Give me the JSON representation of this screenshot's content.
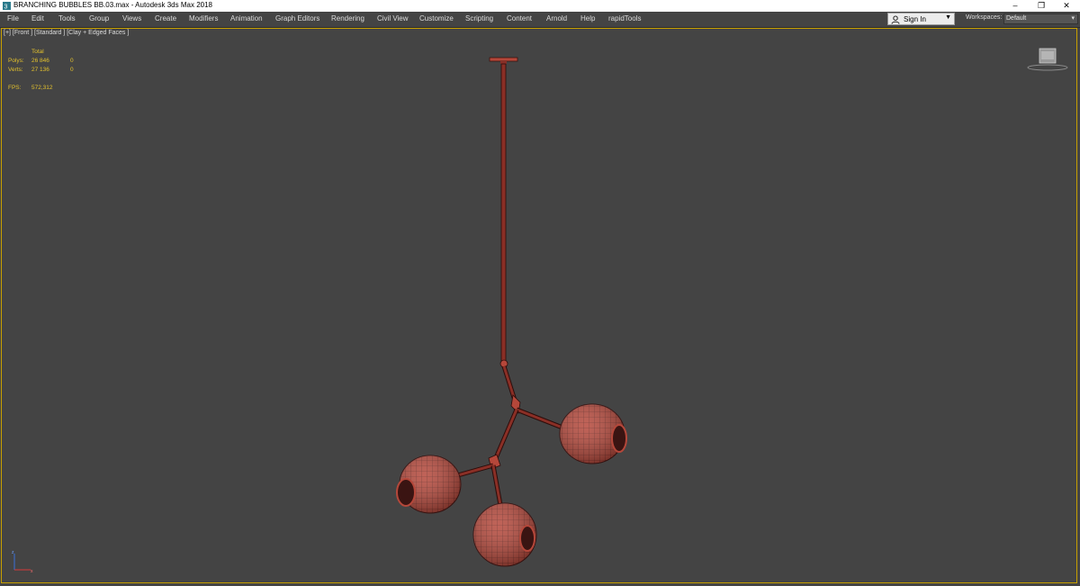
{
  "window": {
    "title": "BRANCHING BUBBLES BB.03.max - Autodesk 3ds Max 2018",
    "minimize": "–",
    "restore": "❐",
    "close": "✕"
  },
  "menu": [
    "File",
    "Edit",
    "Tools",
    "Group",
    "Views",
    "Create",
    "Modifiers",
    "Animation",
    "Graph Editors",
    "Rendering",
    "Civil View",
    "Customize",
    "Scripting",
    "Content",
    "Arnold",
    "Help",
    "rapidTools"
  ],
  "signin": {
    "label": "Sign In",
    "icon": "user-icon"
  },
  "workspaces": {
    "label": "Workspaces:",
    "value": "Default"
  },
  "viewport": {
    "label": "[+] [Front ] [Standard ] [Clay + Edged Faces ]",
    "stats": {
      "header": "Total",
      "polys_label": "Polys:",
      "polys_total": "26 846",
      "polys_sel": "0",
      "verts_label": "Verts:",
      "verts_total": "27 136",
      "verts_sel": "0",
      "fps_label": "FPS:",
      "fps_value": "572,312"
    },
    "viewcube_icon": "viewcube-icon",
    "axis_icon": "axis-tripod-icon"
  },
  "colors": {
    "viewport_bg": "#444444",
    "mesh_red": "#b5473a",
    "stats_yellow": "#e3c12d",
    "active_border": "#c8a000"
  }
}
